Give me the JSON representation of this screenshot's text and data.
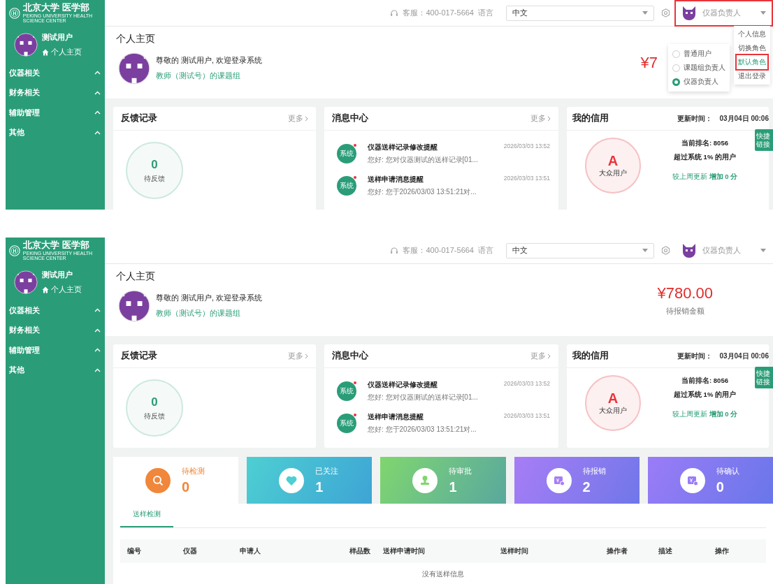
{
  "screens": [
    {
      "sidebar": {
        "logo_title": "北京大学 医学部",
        "logo_subtitle": "PEKING UNIVERSITY HEALTH SCIENCE CENTER",
        "user_name": "测试用户",
        "home_link": "个人主页",
        "groups": [
          {
            "label": "仪器相关"
          },
          {
            "label": "财务相关"
          },
          {
            "label": "辅助管理"
          },
          {
            "label": "其他"
          }
        ]
      },
      "header": {
        "service": "客服：400-017-5664",
        "language_label": "语言",
        "language": "中文",
        "role": "仪器负责人",
        "highlighted": true
      },
      "user_menu": {
        "items": [
          {
            "label": "个人信息",
            "selected": false,
            "highlighted": false
          },
          {
            "label": "切换角色",
            "selected": false,
            "highlighted": false
          },
          {
            "label": "默认角色",
            "selected": true,
            "highlighted": true
          },
          {
            "label": "退出登录",
            "selected": false,
            "highlighted": false
          }
        ]
      },
      "role_menu": {
        "options": [
          {
            "label": "普通用户",
            "selected": false
          },
          {
            "label": "课题组负责人",
            "selected": false
          },
          {
            "label": "仪器负责人",
            "selected": true
          }
        ]
      },
      "page_title": "个人主页",
      "welcome": "尊敬的 测试用户, 欢迎登录系统",
      "group_link": "教师（测试号）的课题组",
      "amount": {
        "value": "¥7"
      },
      "feedback": {
        "title": "反馈记录",
        "more": "更多",
        "count": "0",
        "count_label": "待反馈"
      },
      "messages": {
        "title": "消息中心",
        "more": "更多",
        "items": [
          {
            "badge": "系统",
            "unread": true,
            "title": "仪器送样记录修改提醒",
            "time": "2026/03/03 13:52",
            "preview": "您好: 您对仪器测试的送样记录[01..."
          },
          {
            "badge": "系统",
            "unread": true,
            "title": "送样申请消息提醒",
            "time": "2026/03/03 13:51",
            "preview": "您好: 您于2026/03/03 13:51:21对..."
          }
        ]
      },
      "credit": {
        "title": "我的信用",
        "update_label": "更新时间：",
        "update_time": "03月04日 00:06",
        "grade": "A",
        "grade_label": "大众用户",
        "rank": "当前排名: 8056",
        "exceed": "超过系统 1% 的用户",
        "change": "较上周更新 **增加 0 分**",
        "quick_link": "快捷链接"
      }
    },
    {
      "sidebar": {
        "logo_title": "北京大学 医学部",
        "logo_subtitle": "PEKING UNIVERSITY HEALTH SCIENCE CENTER",
        "user_name": "测试用户",
        "home_link": "个人主页",
        "groups": [
          {
            "label": "仪器相关"
          },
          {
            "label": "财务相关"
          },
          {
            "label": "辅助管理"
          },
          {
            "label": "其他"
          }
        ]
      },
      "header": {
        "service": "客服：400-017-5664",
        "language_label": "语言",
        "language": "中文",
        "role": "仪器负责人",
        "highlighted": false
      },
      "page_title": "个人主页",
      "welcome": "尊敬的 测试用户, 欢迎登录系统",
      "group_link": "教师（测试号）的课题组",
      "amount": {
        "value": "¥780.00",
        "label": "待报销金额"
      },
      "feedback": {
        "title": "反馈记录",
        "more": "更多",
        "count": "0",
        "count_label": "待反馈"
      },
      "messages": {
        "title": "消息中心",
        "more": "更多",
        "items": [
          {
            "badge": "系统",
            "unread": true,
            "title": "仪器送样记录修改提醒",
            "time": "2026/03/03 13:52",
            "preview": "您好: 您对仪器测试的送样记录[01..."
          },
          {
            "badge": "系统",
            "unread": true,
            "title": "送样申请消息提醒",
            "time": "2026/03/03 13:51",
            "preview": "您好: 您于2026/03/03 13:51:21对..."
          }
        ]
      },
      "credit": {
        "title": "我的信用",
        "update_label": "更新时间：",
        "update_time": "03月04日 00:06",
        "grade": "A",
        "grade_label": "大众用户",
        "rank": "当前排名: 8056",
        "exceed": "超过系统 1% 的用户",
        "change": "较上周更新 **增加 0 分**",
        "quick_link": "快捷链接"
      },
      "stats": [
        {
          "kind": "search",
          "label": "待检测",
          "value": "0",
          "selected": true,
          "color": "#f0873a"
        },
        {
          "kind": "heart",
          "label": "已关注",
          "value": "1",
          "selected": false,
          "color": "#4ecfd2"
        },
        {
          "kind": "stamp",
          "label": "待审批",
          "value": "1",
          "selected": false,
          "color": "#80d66c"
        },
        {
          "kind": "invoice",
          "label": "待报销",
          "value": "2",
          "selected": false,
          "color": "#a77df6"
        },
        {
          "kind": "invoice",
          "label": "待确认",
          "value": "0",
          "selected": false,
          "color": "#9a7cf7"
        }
      ],
      "table": {
        "tabs": [
          {
            "label": "送样检测",
            "selected": true
          }
        ],
        "columns": [
          "编号",
          "仪器",
          "申请人",
          "样品数",
          "送样申请时间",
          "送样时间",
          "操作者",
          "描述",
          "操作"
        ],
        "empty": "没有送样信息"
      }
    }
  ]
}
